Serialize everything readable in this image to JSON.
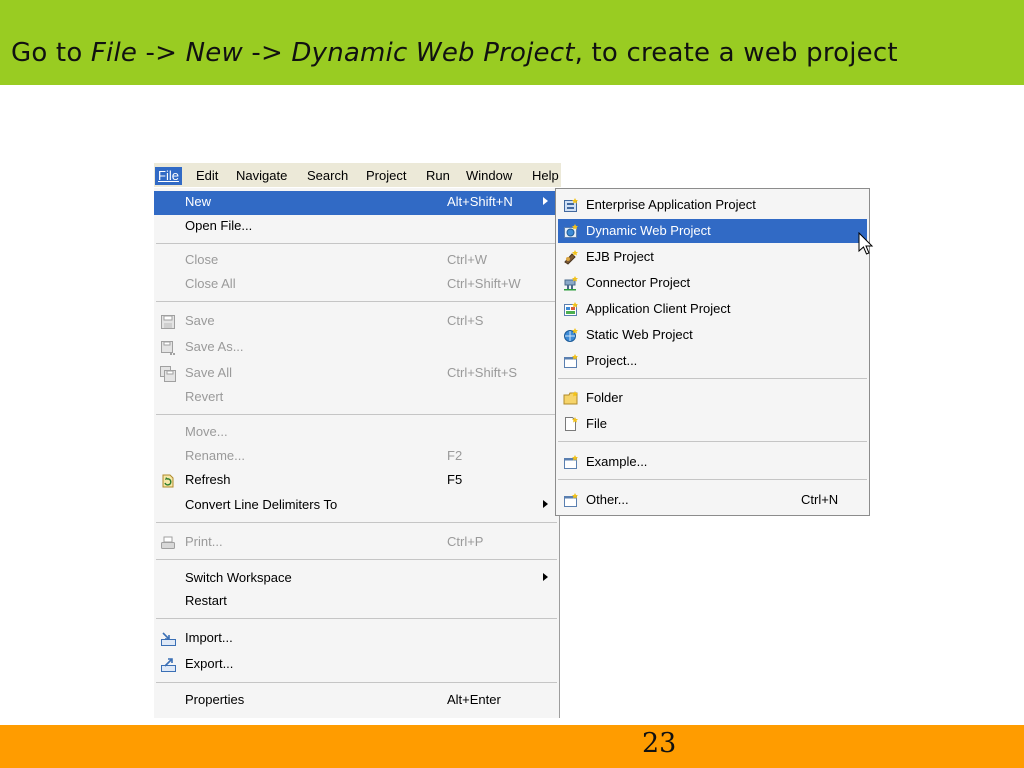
{
  "slide": {
    "title_prefix": "Go to ",
    "title_file": "File",
    "title_arrow1": " -> ",
    "title_new": "New",
    "title_arrow2": " -> ",
    "title_dwp": "Dynamic Web Project",
    "title_suffix": ", to create a web project",
    "page_number": "23",
    "colors": {
      "title_bar": "#99cc22",
      "footer_bar": "#ff9c00",
      "selection": "#316ac5"
    }
  },
  "menubar": {
    "items": [
      "File",
      "Edit",
      "Navigate",
      "Search",
      "Project",
      "Run",
      "Window",
      "Help"
    ],
    "active": "File"
  },
  "file_menu": {
    "items": [
      {
        "label": "New",
        "shortcut": "Alt+Shift+N",
        "submenu": true,
        "selected": true
      },
      {
        "label": "Open File...",
        "shortcut": ""
      },
      {
        "label": "Close",
        "shortcut": "Ctrl+W",
        "disabled": true
      },
      {
        "label": "Close All",
        "shortcut": "Ctrl+Shift+W",
        "disabled": true
      },
      {
        "label": "Save",
        "shortcut": "Ctrl+S",
        "disabled": true,
        "icon": "save-icon"
      },
      {
        "label": "Save As...",
        "shortcut": "",
        "disabled": true,
        "icon": "save-as-icon"
      },
      {
        "label": "Save All",
        "shortcut": "Ctrl+Shift+S",
        "disabled": true,
        "icon": "save-all-icon"
      },
      {
        "label": "Revert",
        "shortcut": "",
        "disabled": true
      },
      {
        "label": "Move...",
        "shortcut": "",
        "disabled": true
      },
      {
        "label": "Rename...",
        "shortcut": "F2",
        "disabled": true
      },
      {
        "label": "Refresh",
        "shortcut": "F5",
        "icon": "refresh-icon"
      },
      {
        "label": "Convert Line Delimiters To",
        "shortcut": "",
        "submenu": true
      },
      {
        "label": "Print...",
        "shortcut": "Ctrl+P",
        "disabled": true,
        "icon": "print-icon"
      },
      {
        "label": "Switch Workspace",
        "shortcut": "",
        "submenu": true
      },
      {
        "label": "Restart",
        "shortcut": ""
      },
      {
        "label": "Import...",
        "shortcut": "",
        "icon": "import-icon"
      },
      {
        "label": "Export...",
        "shortcut": "",
        "icon": "export-icon"
      },
      {
        "label": "Properties",
        "shortcut": "Alt+Enter"
      }
    ]
  },
  "new_submenu": {
    "items": [
      {
        "label": "Enterprise Application Project",
        "icon": "enterprise-project-icon"
      },
      {
        "label": "Dynamic Web Project",
        "icon": "dynamic-web-project-icon",
        "selected": true
      },
      {
        "label": "EJB Project",
        "icon": "ejb-project-icon"
      },
      {
        "label": "Connector Project",
        "icon": "connector-project-icon"
      },
      {
        "label": "Application Client Project",
        "icon": "app-client-project-icon"
      },
      {
        "label": "Static Web Project",
        "icon": "static-web-project-icon"
      },
      {
        "label": "Project...",
        "icon": "project-icon"
      },
      {
        "label": "Folder",
        "icon": "folder-icon"
      },
      {
        "label": "File",
        "icon": "file-icon"
      },
      {
        "label": "Example...",
        "icon": "example-icon"
      },
      {
        "label": "Other...",
        "shortcut": "Ctrl+N",
        "icon": "other-icon"
      }
    ]
  }
}
